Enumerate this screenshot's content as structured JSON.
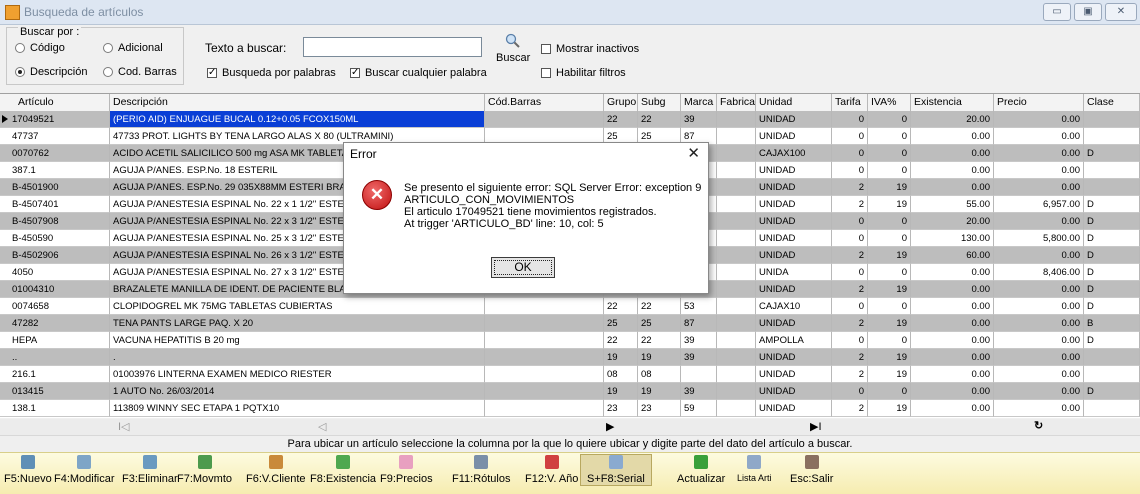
{
  "window": {
    "title": "Busqueda de artículos",
    "controls": [
      "min",
      "max",
      "close"
    ]
  },
  "search": {
    "group_label": "Buscar por :",
    "radios": [
      {
        "label": "Código",
        "checked": false
      },
      {
        "label": "Adicional",
        "checked": false
      },
      {
        "label": "Descripción",
        "checked": true
      },
      {
        "label": "Cod. Barras",
        "checked": false
      }
    ],
    "text_label": "Texto a buscar:",
    "text_value": "",
    "chk_palabras": {
      "label": "Busqueda por palabras",
      "checked": true
    },
    "chk_cualquier": {
      "label": "Buscar cualquier palabra",
      "checked": true
    },
    "search_button": "Buscar",
    "chk_inactivos": {
      "label": "Mostrar inactivos",
      "checked": false
    },
    "chk_filtros": {
      "label": "Habilitar filtros",
      "checked": false
    }
  },
  "grid": {
    "columns": [
      "Artículo",
      "Descripción",
      "Cód.Barras",
      "Grupo",
      "Subg",
      "Marca",
      "Fabrica",
      "Unidad",
      "Tarifa",
      "IVA%",
      "Existencia",
      "Precio",
      "Clase"
    ],
    "rows": [
      [
        "17049521",
        "(PERIO AID) ENJUAGUE BUCAL 0.12+0.05 FCOX150ML",
        "",
        "22",
        "22",
        "39",
        "",
        "UNIDAD",
        "0",
        "0",
        "20.00",
        "0.00",
        ""
      ],
      [
        "47737",
        "47733 PROT. LIGHTS BY TENA LARGO ALAS X 80 (ULTRAMINI)",
        "",
        "25",
        "25",
        "87",
        "",
        "UNIDAD",
        "0",
        "0",
        "0.00",
        "0.00",
        ""
      ],
      [
        "0070762",
        "ACIDO ACETIL SALICILICO 500 mg ASA MK  TABLETAS",
        "",
        "",
        "",
        "",
        "",
        "CAJAX100",
        "0",
        "0",
        "0.00",
        "0.00",
        "D"
      ],
      [
        "387.1",
        "AGUJA P/ANES. ESP.No. 18 ESTERIL",
        "",
        "",
        "",
        "",
        "",
        "UNIDAD",
        "0",
        "0",
        "0.00",
        "0.00",
        ""
      ],
      [
        "B-4501900",
        "AGUJA P/ANES. ESP.No. 29  035X88MM ESTERI BRAUN",
        "",
        "",
        "",
        "",
        "",
        "UNIDAD",
        "2",
        "19",
        "0.00",
        "0.00",
        ""
      ],
      [
        "B-4507401",
        "AGUJA P/ANESTESIA ESPINAL No. 22 x 1 1/2'' ESTERIL",
        "",
        "",
        "",
        "",
        "",
        "UNIDAD",
        "2",
        "19",
        "55.00",
        "6,957.00",
        "D"
      ],
      [
        "B-4507908",
        "AGUJA P/ANESTESIA ESPINAL No. 22 x 3 1/2'' ESTERIL",
        "",
        "",
        "",
        "",
        "",
        "UNIDAD",
        "0",
        "0",
        "20.00",
        "0.00",
        "D"
      ],
      [
        "B-450590",
        "AGUJA P/ANESTESIA ESPINAL No. 25 x 3 1/2'' ESTERIL",
        "",
        "",
        "",
        "",
        "",
        "UNIDAD",
        "0",
        "0",
        "130.00",
        "5,800.00",
        "D"
      ],
      [
        "B-4502906",
        "AGUJA P/ANESTESIA ESPINAL No. 26 x 3 1/2'' ESTERIL",
        "",
        "",
        "",
        "",
        "",
        "UNIDAD",
        "2",
        "19",
        "60.00",
        "0.00",
        "D"
      ],
      [
        "4050",
        "AGUJA P/ANESTESIA ESPINAL No. 27 x 3 1/2'' ESTERIL",
        "",
        "",
        "",
        "",
        "",
        "UNIDA",
        "0",
        "0",
        "0.00",
        "8,406.00",
        "D"
      ],
      [
        "01004310",
        "BRAZALETE MANILLA DE IDENT. DE PACIENTE BLANCO",
        "",
        "",
        "",
        "",
        "",
        "UNIDAD",
        "2",
        "19",
        "0.00",
        "0.00",
        "D"
      ],
      [
        "0074658",
        "CLOPIDOGREL MK 75MG TABLETAS CUBIERTAS",
        "",
        "22",
        "22",
        "53",
        "",
        "CAJAX10",
        "0",
        "0",
        "0.00",
        "0.00",
        "D"
      ],
      [
        "47282",
        "TENA PANTS LARGE PAQ. X 20",
        "",
        "25",
        "25",
        "87",
        "",
        "UNIDAD",
        "2",
        "19",
        "0.00",
        "0.00",
        "B"
      ],
      [
        "HEPA",
        "VACUNA HEPATITIS B 20 mg",
        "",
        "22",
        "22",
        "39",
        "",
        "AMPOLLA",
        "0",
        "0",
        "0.00",
        "0.00",
        "D"
      ],
      [
        "..",
        ".",
        "",
        "19",
        "19",
        "39",
        "",
        "UNIDAD",
        "2",
        "19",
        "0.00",
        "0.00",
        ""
      ],
      [
        "216.1",
        "01003976 LINTERNA EXAMEN MEDICO RIESTER",
        "",
        "08",
        "08",
        "",
        "",
        "UNIDAD",
        "2",
        "19",
        "0.00",
        "0.00",
        ""
      ],
      [
        "013415",
        "1 AUTO No. 26/03/2014",
        "",
        "19",
        "19",
        "39",
        "",
        "UNIDAD",
        "0",
        "0",
        "0.00",
        "0.00",
        "D"
      ],
      [
        "138.1",
        "113809 WINNY SEC ETAPA 1 PQTX10",
        "",
        "23",
        "23",
        "59",
        "",
        "UNIDAD",
        "2",
        "19",
        "0.00",
        "0.00",
        ""
      ]
    ]
  },
  "nav": {
    "first": "I◁",
    "prev": "◁",
    "next": "▶",
    "last": "▶I",
    "refresh": "↻"
  },
  "hint": "Para ubicar un artículo seleccione la columna por la que lo quiere ubicar y digite parte del dato del artículo a buscar.",
  "toolbar": [
    {
      "key": "new",
      "label": "F5:Nuevo",
      "color": "#5f8fb6"
    },
    {
      "key": "edit",
      "label": "F4:Modificar",
      "color": "#7ea5c7"
    },
    {
      "key": "delete",
      "label": "F3:Eliminar",
      "color": "#6a9ac0"
    },
    {
      "key": "movement",
      "label": "F7:Movmto",
      "color": "#4d9a4d"
    },
    {
      "key": "client",
      "label": "F6:V.Cliente",
      "color": "#c98a3a"
    },
    {
      "key": "stock",
      "label": "F8:Existencia",
      "color": "#4fa84f"
    },
    {
      "key": "prices",
      "label": "F9:Precios",
      "color": "#e8a0c0"
    },
    {
      "key": "labels",
      "label": "F11:Rótulos",
      "color": "#7a8fa8"
    },
    {
      "key": "year",
      "label": "F12:V. Año",
      "color": "#d04040"
    },
    {
      "key": "serial",
      "label": "S+F8:Serial",
      "color": "#8aaad0"
    },
    {
      "key": "refresh",
      "label": "Actualizar",
      "color": "#3aa03a"
    },
    {
      "key": "list",
      "label": "Lista Arti",
      "color": "#8fa8c8"
    },
    {
      "key": "exit",
      "label": "Esc:Salir",
      "color": "#8a7060"
    }
  ],
  "dialog": {
    "title": "Error",
    "close": "✕",
    "icon": "error-icon",
    "lines": [
      "Se presento el siguiente error: SQL Server Error: exception 9",
      "ARTICULO_CON_MOVIMIENTOS",
      "El articulo 17049521 tiene movimientos registrados.",
      "At trigger 'ARTICULO_BD' line: 10, col: 5"
    ],
    "ok": "OK"
  }
}
